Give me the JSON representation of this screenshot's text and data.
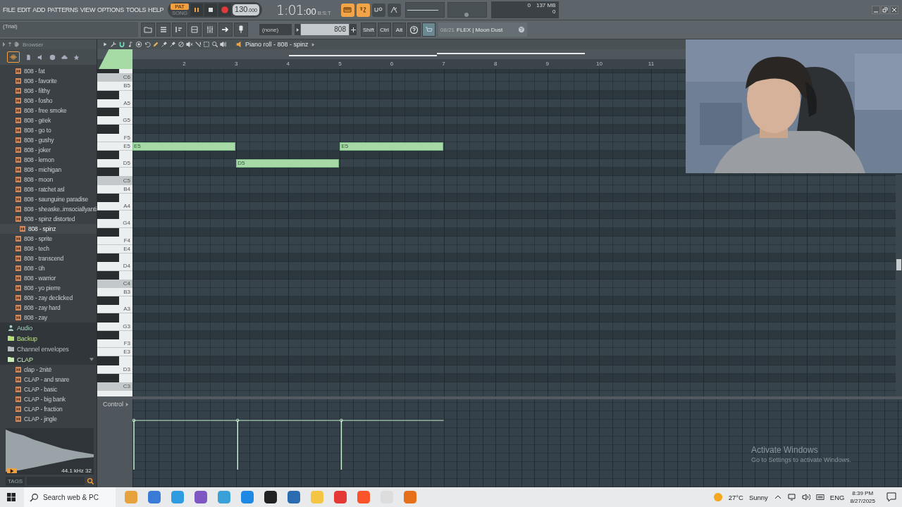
{
  "menu": [
    "FILE",
    "EDIT",
    "ADD",
    "PATTERNS",
    "VIEW",
    "OPTIONS",
    "TOOLS",
    "HELP"
  ],
  "pattern_mode": [
    {
      "label": "PAT",
      "selected": true
    },
    {
      "label": "SONG",
      "selected": false
    }
  ],
  "tempo": {
    "whole": "130",
    "fraction": ".000"
  },
  "time": {
    "main": "1:01",
    "ticks": ":00",
    "format": "B:S:T"
  },
  "toggles": [
    {
      "kind": "typing",
      "on": true
    },
    {
      "kind": "countdown",
      "on": true
    },
    {
      "kind": "wait",
      "on": false
    },
    {
      "kind": "metronome",
      "on": false
    }
  ],
  "master": [
    {
      "kind": "volume",
      "level": 0.85
    },
    {
      "kind": "pitch",
      "level": 0.5
    }
  ],
  "monitor": {
    "cpu": "0",
    "memory": "137 MB",
    "polyphony": "0"
  },
  "hint": "(Trial)",
  "snap": "(none)",
  "pattern_field": {
    "value": "808"
  },
  "modifier_keys": [
    "Shift",
    "Ctrl",
    "Alt"
  ],
  "news": {
    "date": "08/21",
    "title": "FLEX | Moon Dust"
  },
  "browser": {
    "title": "Browser",
    "items": [
      {
        "kind": "sample",
        "label": "808 - fat",
        "selected": false
      },
      {
        "kind": "sample",
        "label": "808 - favorite",
        "selected": false
      },
      {
        "kind": "sample",
        "label": "808 - filthy",
        "selected": false
      },
      {
        "kind": "sample",
        "label": "808 - fosho",
        "selected": false
      },
      {
        "kind": "sample",
        "label": "808 - free smoke",
        "selected": false
      },
      {
        "kind": "sample",
        "label": "808 - gëek",
        "selected": false
      },
      {
        "kind": "sample",
        "label": "808 - go to",
        "selected": false
      },
      {
        "kind": "sample",
        "label": "808 - gushy",
        "selected": false
      },
      {
        "kind": "sample",
        "label": "808 - joker",
        "selected": false
      },
      {
        "kind": "sample",
        "label": "808 - lemon",
        "selected": false
      },
      {
        "kind": "sample",
        "label": "808 - michigan",
        "selected": false
      },
      {
        "kind": "sample",
        "label": "808 - moon",
        "selected": false
      },
      {
        "kind": "sample",
        "label": "808 - ratchet asl",
        "selected": false
      },
      {
        "kind": "sample",
        "label": "808 - saunguine paradise",
        "selected": false
      },
      {
        "kind": "sample",
        "label": "808 - sheaske..imsociallyanti",
        "selected": false
      },
      {
        "kind": "sample",
        "label": "808 - spinz distorted",
        "selected": false
      },
      {
        "kind": "sample",
        "label": "808 - spinz",
        "selected": true
      },
      {
        "kind": "sample",
        "label": "808 - sprite",
        "selected": false
      },
      {
        "kind": "sample",
        "label": "808 - tech",
        "selected": false
      },
      {
        "kind": "sample",
        "label": "808 - transcend",
        "selected": false
      },
      {
        "kind": "sample",
        "label": "808 - ūh",
        "selected": false
      },
      {
        "kind": "sample",
        "label": "808 - warrior",
        "selected": false
      },
      {
        "kind": "sample",
        "label": "808 - yo pierre",
        "selected": false
      },
      {
        "kind": "sample",
        "label": "808 - zay declicked",
        "selected": false
      },
      {
        "kind": "sample",
        "label": "808 - zay hard",
        "selected": false
      },
      {
        "kind": "sample",
        "label": "808 - zay",
        "selected": false
      },
      {
        "kind": "user",
        "label": "Audio",
        "color": "#a9d3c0",
        "expanded": false
      },
      {
        "kind": "folder",
        "label": "Backup",
        "color": "#b7e07c",
        "expanded": false
      },
      {
        "kind": "folder",
        "label": "Channel envelopes",
        "color": "#b3bcc1",
        "expanded": false
      },
      {
        "kind": "folder",
        "label": "CLAP",
        "color": "#c9ecb4",
        "expanded": true,
        "children": [
          {
            "kind": "sample",
            "label": "clap - 2nitē",
            "selected": false
          },
          {
            "kind": "sample",
            "label": "CLAP - and snare",
            "selected": false
          },
          {
            "kind": "sample",
            "label": "CLAP - basic",
            "selected": false
          },
          {
            "kind": "sample",
            "label": "CLAP - big bank",
            "selected": false
          },
          {
            "kind": "sample",
            "label": "CLAP - fraction",
            "selected": false
          },
          {
            "kind": "sample",
            "label": "CLAP - jingle",
            "selected": false
          }
        ]
      }
    ]
  },
  "preview": {
    "info": "44.1 kHz 32"
  },
  "tags": {
    "label": "TAGS"
  },
  "piano_roll": {
    "title": "Piano roll - 808 - spinz",
    "ruler": [
      "2",
      "3",
      "4",
      "5",
      "6",
      "7",
      "8",
      "9",
      "10",
      "11"
    ],
    "keys": [
      {
        "label": "C6"
      },
      {
        "label": "B5"
      },
      {
        "label": "A5"
      },
      {
        "label": "G5"
      },
      {
        "label": "F5"
      },
      {
        "label": "E5",
        "slots": [
          {
            "kind": "note",
            "label": "E5"
          },
          {
            "kind": "rest"
          },
          {
            "kind": "note",
            "label": "E5"
          }
        ]
      },
      {
        "label": "D5",
        "slots": [
          {
            "kind": "rest"
          },
          {
            "kind": "note",
            "label": "D5"
          }
        ]
      },
      {
        "label": "C5"
      },
      {
        "label": "B4"
      },
      {
        "label": "A4"
      },
      {
        "label": "G4"
      },
      {
        "label": "F4"
      },
      {
        "label": "E4"
      },
      {
        "label": "D4"
      },
      {
        "label": "C4"
      },
      {
        "label": "B3"
      },
      {
        "label": "A3"
      },
      {
        "label": "G3"
      },
      {
        "label": "F3"
      },
      {
        "label": "E3"
      },
      {
        "label": "D3"
      },
      {
        "label": "C3"
      }
    ],
    "control": {
      "label": "Control"
    }
  },
  "os_notice": {
    "title": "Activate Windows",
    "subtitle": "Go to Settings to activate Windows."
  },
  "taskbar": {
    "search_placeholder": "Search web & PC",
    "temperature": "27°C",
    "weather": "Sunny",
    "language": "ENG",
    "time": "8:39 PM",
    "date": "8/27/2025"
  }
}
